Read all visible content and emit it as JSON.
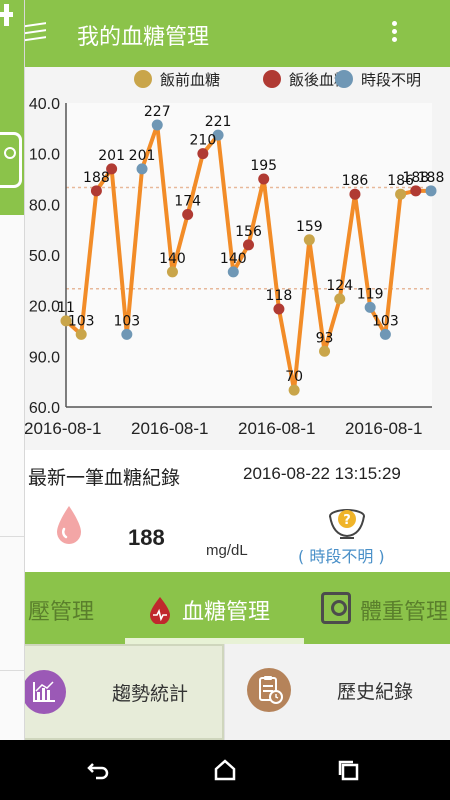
{
  "app_bar": {
    "title": "我的血糖管理",
    "menu_icon": "hamburger-menu-icon",
    "overflow_icon": "more-vert-icon"
  },
  "colors": {
    "primary_green": "#8bc34a",
    "line_orange": "#f28c28",
    "before_meal": "#c9a54a",
    "after_meal": "#b03a33",
    "unknown_time": "#6f97b5"
  },
  "chart_data": {
    "type": "line",
    "y_ticks": [
      "40.0",
      "10.0",
      "80.0",
      "50.0",
      "20.0",
      "90.0",
      "60.0"
    ],
    "x_ticks": [
      "2016-08-1",
      "2016-08-1",
      "2016-08-1",
      "2016-08-1"
    ],
    "legend": [
      {
        "name": "飯前血糖",
        "color": "#c9a54a"
      },
      {
        "name": "飯後血糖",
        "color": "#b03a33"
      },
      {
        "name": "時段不明",
        "color": "#6f97b5"
      }
    ],
    "legend_position": "top-right",
    "reference_lines": [
      190,
      130
    ],
    "ylim": [
      60,
      240
    ],
    "points": [
      {
        "label": "11",
        "value": 111,
        "category": "before"
      },
      {
        "label": "103",
        "value": 103,
        "category": "before"
      },
      {
        "label": "188",
        "value": 188,
        "category": "after"
      },
      {
        "label": "201",
        "value": 201,
        "category": "after"
      },
      {
        "label": "103",
        "value": 103,
        "category": "unknown"
      },
      {
        "label": "201",
        "value": 201,
        "category": "unknown"
      },
      {
        "label": "227",
        "value": 227,
        "category": "unknown"
      },
      {
        "label": "140",
        "value": 140,
        "category": "before"
      },
      {
        "label": "174",
        "value": 174,
        "category": "after"
      },
      {
        "label": "210",
        "value": 210,
        "category": "after"
      },
      {
        "label": "221",
        "value": 221,
        "category": "unknown"
      },
      {
        "label": "140",
        "value": 140,
        "category": "unknown"
      },
      {
        "label": "156",
        "value": 156,
        "category": "after"
      },
      {
        "label": "195",
        "value": 195,
        "category": "after"
      },
      {
        "label": "118",
        "value": 118,
        "category": "after"
      },
      {
        "label": "70",
        "value": 70,
        "category": "before"
      },
      {
        "label": "159",
        "value": 159,
        "category": "before"
      },
      {
        "label": "93",
        "value": 93,
        "category": "before"
      },
      {
        "label": "124",
        "value": 124,
        "category": "before"
      },
      {
        "label": "186",
        "value": 186,
        "category": "after"
      },
      {
        "label": "119",
        "value": 119,
        "category": "unknown"
      },
      {
        "label": "103",
        "value": 103,
        "category": "unknown"
      },
      {
        "label": "186",
        "value": 186,
        "category": "before"
      },
      {
        "label": "188",
        "value": 188,
        "category": "after"
      },
      {
        "label": "188",
        "value": 188,
        "category": "unknown"
      }
    ]
  },
  "latest": {
    "label": "最新一筆血糖紀錄",
    "datetime": "2016-08-22 13:15:29",
    "value": "188",
    "unit": "mg/dL",
    "period": "( 時段不明 )",
    "drop_icon": "blood-drop-icon",
    "bowl_icon": "question-bowl-icon"
  },
  "tabs": [
    {
      "label": "壓管理",
      "icon": ""
    },
    {
      "label": "血糖管理",
      "icon": "blood-sugar-icon",
      "selected": true
    },
    {
      "label": "體重管理",
      "icon": "scale-icon"
    }
  ],
  "features": {
    "trend": {
      "label": "趨勢統計",
      "icon": "bar-chart-icon"
    },
    "history": {
      "label": "歷史紀錄",
      "icon": "history-list-icon"
    }
  },
  "nav": {
    "back_icon": "back-icon",
    "home_icon": "home-icon",
    "recents_icon": "recents-icon"
  }
}
